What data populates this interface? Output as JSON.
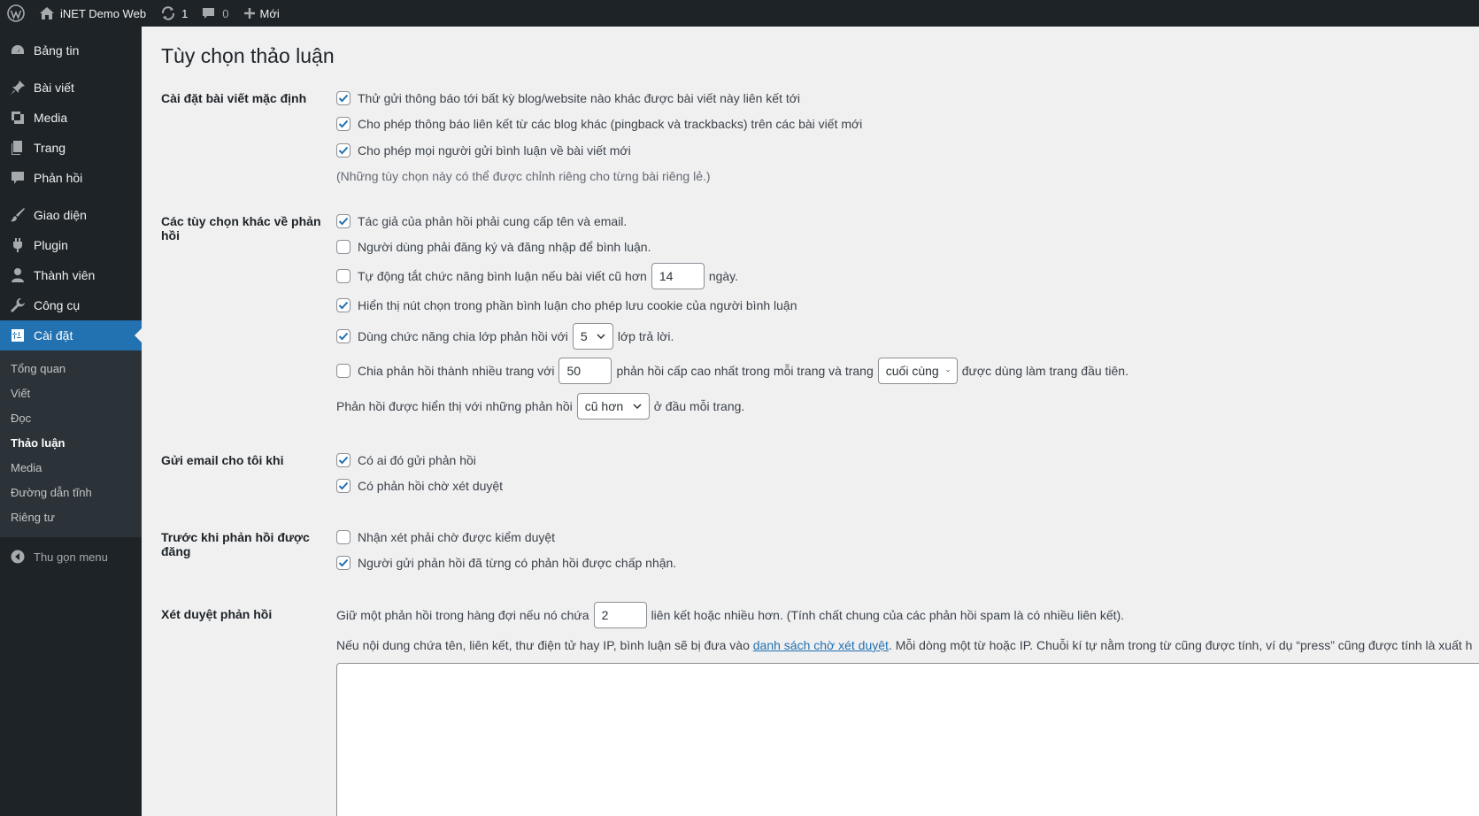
{
  "adminbar": {
    "site_name": "iNET Demo Web",
    "updates_count": "1",
    "comments_count": "0",
    "new_label": "Mới"
  },
  "sidebar": {
    "items": [
      {
        "label": "Bảng tin",
        "icon": "dashboard-icon"
      },
      {
        "label": "Bài viết",
        "icon": "pin-icon"
      },
      {
        "label": "Media",
        "icon": "media-icon"
      },
      {
        "label": "Trang",
        "icon": "page-icon"
      },
      {
        "label": "Phản hồi",
        "icon": "comment-icon"
      },
      {
        "label": "Giao diện",
        "icon": "brush-icon"
      },
      {
        "label": "Plugin",
        "icon": "plugin-icon"
      },
      {
        "label": "Thành viên",
        "icon": "user-icon"
      },
      {
        "label": "Công cụ",
        "icon": "wrench-icon"
      },
      {
        "label": "Cài đặt",
        "icon": "settings-icon"
      }
    ],
    "submenu": [
      "Tổng quan",
      "Viết",
      "Đọc",
      "Thảo luận",
      "Media",
      "Đường dẫn tĩnh",
      "Riêng tư"
    ],
    "submenu_active": "Thảo luận",
    "collapse_label": "Thu gọn menu"
  },
  "page": {
    "title": "Tùy chọn thảo luận",
    "sections": {
      "default_post": {
        "label": "Cài đặt bài viết mặc định",
        "opt1": "Thử gửi thông báo tới bất kỳ blog/website nào khác được bài viết này liên kết tới",
        "opt2": "Cho phép thông báo liên kết từ các blog khác (pingback và trackbacks) trên các bài viết mới",
        "opt3": "Cho phép mọi người gửi bình luận về bài viết mới",
        "note": "(Những tùy chọn này có thể được chỉnh riêng cho từng bài riêng lẻ.)",
        "checked": [
          true,
          true,
          true
        ]
      },
      "other": {
        "label": "Các tùy chọn khác về phản hồi",
        "opt1": "Tác giả của phản hồi phải cung cấp tên và email.",
        "opt2": "Người dùng phải đăng ký và đăng nhập để bình luận.",
        "opt3_pre": "Tự động tắt chức năng bình luận nếu bài viết cũ hơn",
        "opt3_value": "14",
        "opt3_post": "ngày.",
        "opt4": "Hiển thị nút chọn trong phần bình luận cho phép lưu cookie của người bình luận",
        "opt5_pre": "Dùng chức năng chia lớp phản hồi với",
        "opt5_value": "5",
        "opt5_post": "lớp trả lời.",
        "opt6_pre": "Chia phản hồi thành nhiều trang với",
        "opt6_value": "50",
        "opt6_mid": "phản hồi cấp cao nhất trong mỗi trang và trang",
        "opt6_select": "cuối cùng",
        "opt6_post": "được dùng làm trang đầu tiên.",
        "opt7_pre": "Phản hồi được hiển thị với những phản hồi",
        "opt7_select": "cũ hơn",
        "opt7_post": "ở đầu mỗi trang.",
        "checked": [
          true,
          false,
          false,
          true,
          true,
          false
        ]
      },
      "email": {
        "label": "Gửi email cho tôi khi",
        "opt1": "Có ai đó gửi phản hồi",
        "opt2": "Có phản hồi chờ xét duyệt",
        "checked": [
          true,
          true
        ]
      },
      "before": {
        "label": "Trước khi phản hồi được đăng",
        "opt1": "Nhận xét phải chờ được kiểm duyệt",
        "opt2": "Người gửi phản hồi đã từng có phản hồi được chấp nhận.",
        "checked": [
          false,
          true
        ]
      },
      "moderation": {
        "label": "Xét duyệt phản hồi",
        "line1_pre": "Giữ một phản hồi trong hàng đợi nếu nó chứa",
        "line1_value": "2",
        "line1_post": "liên kết hoặc nhiều hơn. (Tính chất chung của các phản hồi spam là có nhiều liên kết).",
        "line2_pre": "Nếu nội dung chứa tên, liên kết, thư điện tử hay IP, bình luận sẽ bị đưa vào",
        "line2_link": "danh sách chờ xét duyệt",
        "line2_post": ". Mỗi dòng một từ hoặc IP. Chuỗi kí tự nằm trong từ cũng được tính, ví dụ “press” cũng được tính là xuất h"
      }
    }
  }
}
